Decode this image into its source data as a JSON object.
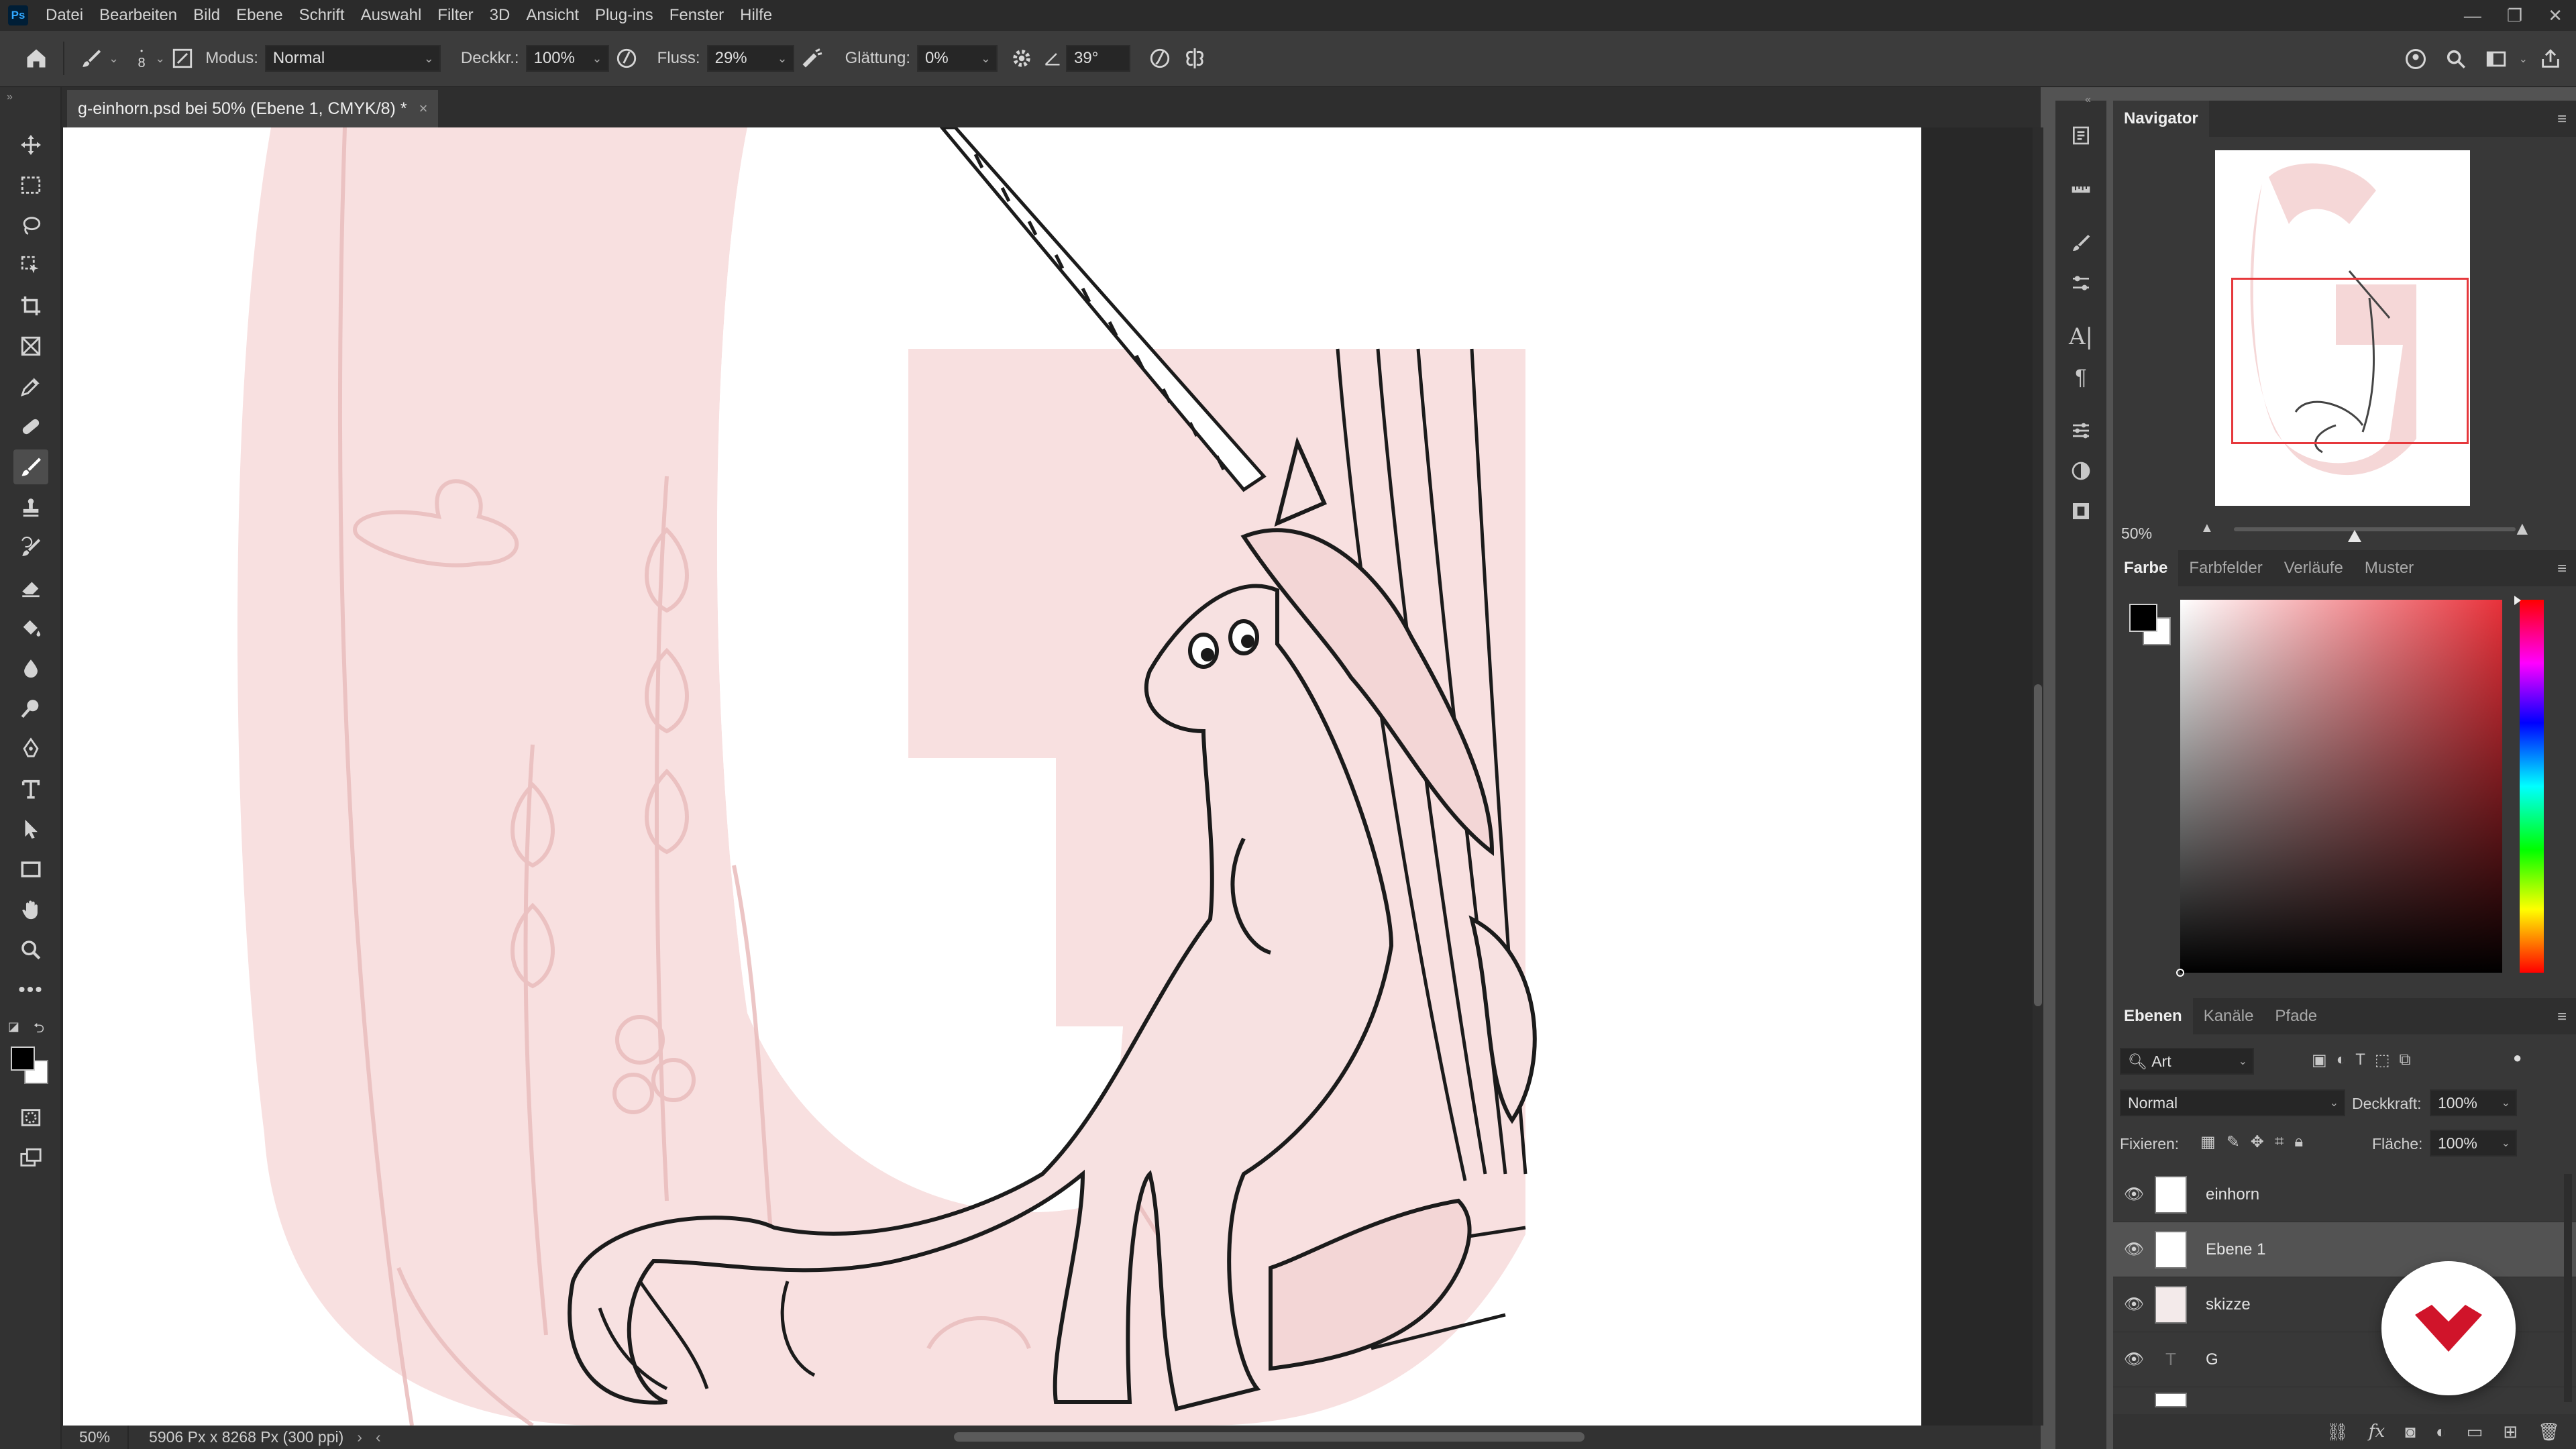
{
  "menubar": {
    "logo": "Ps",
    "items": [
      "Datei",
      "Bearbeiten",
      "Bild",
      "Ebene",
      "Schrift",
      "Auswahl",
      "Filter",
      "3D",
      "Ansicht",
      "Plug-ins",
      "Fenster",
      "Hilfe"
    ],
    "window_controls": [
      "minimize-icon",
      "restore-icon",
      "close-icon"
    ]
  },
  "options": {
    "brush_size": "8",
    "mode_label": "Modus:",
    "mode_value": "Normal",
    "opacity_label": "Deckkr.:",
    "opacity_value": "100%",
    "flow_label": "Fluss:",
    "flow_value": "29%",
    "smoothing_label": "Glättung:",
    "smoothing_value": "0%",
    "angle_value": "39°"
  },
  "document": {
    "tab_title": "g-einhorn.psd bei 50% (Ebene 1, CMYK/8) *",
    "close_glyph": "×"
  },
  "status": {
    "zoom": "50%",
    "doc_size": "5906 Px x 8268 Px (300 ppi)",
    "arrow_right": "›",
    "arrow_left": "‹"
  },
  "navigator": {
    "title": "Navigator",
    "zoom": "50%",
    "zoom_level_fraction": 0.5
  },
  "color_panel": {
    "tabs": [
      "Farbe",
      "Farbfelder",
      "Verläufe",
      "Muster"
    ],
    "foreground": "#000000",
    "background": "#ffffff",
    "selected_hue": "#e8313a"
  },
  "layers_panel": {
    "tabs": [
      "Ebenen",
      "Kanäle",
      "Pfade"
    ],
    "filter_label": "Art",
    "blend_mode": "Normal",
    "opacity_label": "Deckkraft:",
    "opacity_value": "100%",
    "lock_label": "Fixieren:",
    "fill_label": "Fläche:",
    "fill_value": "100%",
    "layers": [
      {
        "name": "einhorn",
        "selected": false,
        "type": "pixel"
      },
      {
        "name": "Ebene 1",
        "selected": true,
        "type": "pixel"
      },
      {
        "name": "skizze",
        "selected": false,
        "type": "pixel"
      },
      {
        "name": "G",
        "selected": false,
        "type": "text"
      }
    ]
  },
  "colors": {
    "accent_pink": "#f8e0e0",
    "sketch_pink": "#e9bcbc",
    "brand_red": "#d0142a"
  }
}
